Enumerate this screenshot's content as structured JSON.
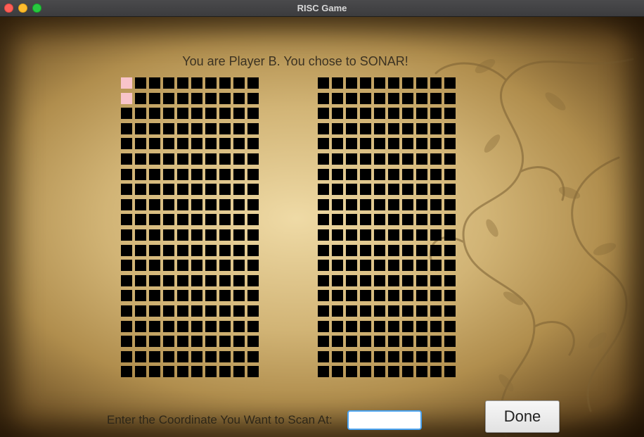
{
  "window": {
    "title": "RISC Game"
  },
  "game": {
    "prompt": "You are Player B. You chose to SONAR!",
    "scan_label": "Enter the Coordinate You Want to Scan At:",
    "scan_value": "",
    "scan_placeholder": "",
    "done_label": "Done"
  },
  "boards": {
    "rows": 20,
    "columns": 10,
    "cell_color": "#000000",
    "hit_color": "#f8c4ca",
    "left_hits": [
      [
        0,
        0
      ],
      [
        1,
        0
      ]
    ],
    "right_hits": []
  },
  "colors": {
    "parchment": "#d9bf85",
    "text": "#3b3222",
    "input_focus": "#4aa3f0"
  }
}
